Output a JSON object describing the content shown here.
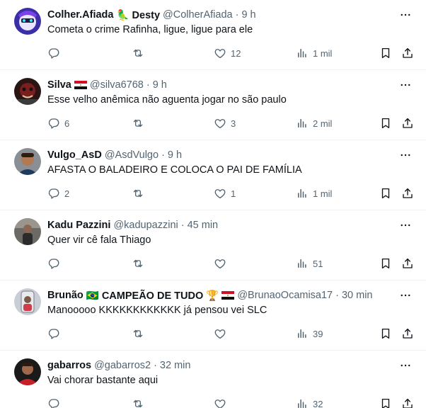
{
  "tweets": [
    {
      "name": "Colher.Afiada",
      "badges": "🦜 Desty",
      "handle": "@ColherAfiada",
      "time": "9 h",
      "text": "Cometa o crime Rafinha, ligue, ligue para ele",
      "replies": "",
      "retweets": "",
      "likes": "12",
      "views": "1 mil"
    },
    {
      "name": "Silva",
      "badges": "flag-egypt",
      "handle": "@silva6768",
      "time": "9 h",
      "text": "Esse velho anêmica não aguenta jogar no são paulo",
      "replies": "6",
      "retweets": "",
      "likes": "3",
      "views": "2 mil"
    },
    {
      "name": "Vulgo_AsD",
      "badges": "",
      "handle": "@AsdVulgo",
      "time": "9 h",
      "text": "AFASTA O BALADEIRO E COLOCA O PAI DE FAMÍLIA",
      "replies": "2",
      "retweets": "",
      "likes": "1",
      "views": "1 mil"
    },
    {
      "name": "Kadu Pazzini",
      "badges": "",
      "handle": "@kadupazzini",
      "time": "45 min",
      "text": "Quer vir cê fala Thiago",
      "replies": "",
      "retweets": "",
      "likes": "",
      "views": "51"
    },
    {
      "name": "Brunão",
      "badges": "🇧🇷 CAMPEÃO DE TUDO 🏆",
      "handle": "@BrunaoOcamisa17",
      "time": "30 min",
      "text": "Manooooo KKKKKKKKKKKK já pensou vei SLC",
      "replies": "",
      "retweets": "",
      "likes": "",
      "views": "39"
    },
    {
      "name": "gabarros",
      "badges": "",
      "handle": "@gabarros2",
      "time": "32 min",
      "text": "Vai chorar bastante aqui",
      "replies": "",
      "retweets": "",
      "likes": "",
      "views": "32"
    }
  ],
  "icons": {
    "reply": "reply-icon",
    "retweet": "retweet-icon",
    "like": "heart-icon",
    "views": "views-chart-icon",
    "bookmark": "bookmark-icon",
    "share": "share-icon",
    "more": "more-dots-icon"
  },
  "colors": {
    "text": "#0f1419",
    "secondary": "#536471",
    "divider": "#eff3f4"
  }
}
